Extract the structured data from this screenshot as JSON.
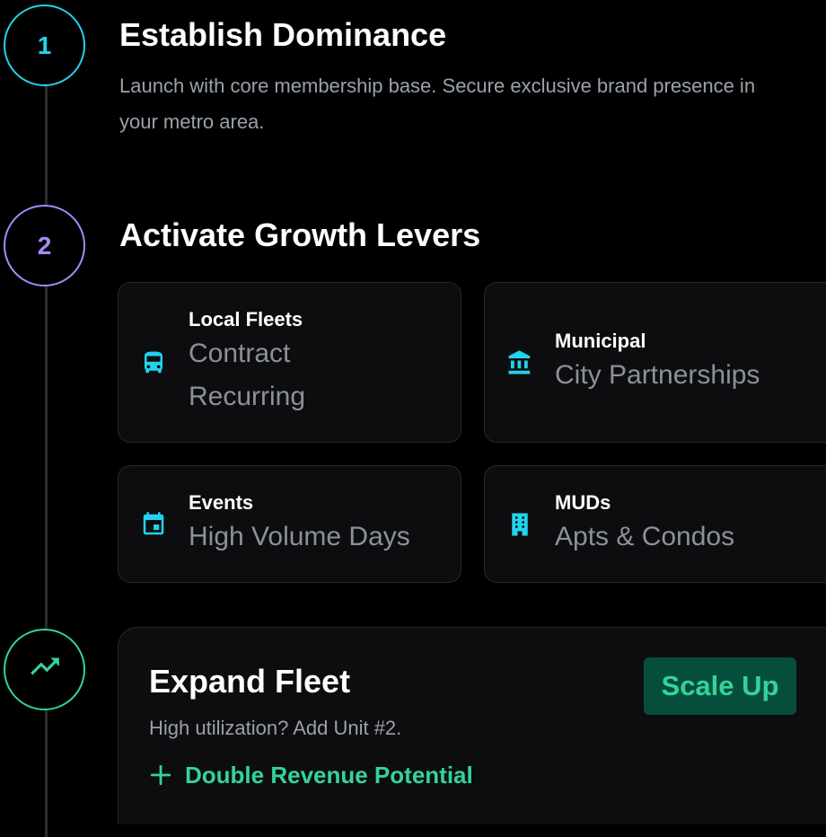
{
  "steps": [
    {
      "number": "1",
      "title": "Establish Dominance",
      "description": "Launch with core membership base. Secure exclusive brand presence in your metro area.",
      "color": "#22d3ee"
    },
    {
      "number": "2",
      "title": "Activate Growth Levers",
      "color": "#a78bfa"
    },
    {
      "icon": "trending-up-icon",
      "color": "#34d399"
    }
  ],
  "levers": [
    {
      "title": "Local Fleets",
      "subtitle": "Contract Recurring",
      "icon": "bus-icon"
    },
    {
      "title": "Municipal",
      "subtitle": "City Partnerships",
      "icon": "bank-icon"
    },
    {
      "title": "Events",
      "subtitle": "High Volume Days",
      "icon": "calendar-icon"
    },
    {
      "title": "MUDs",
      "subtitle": "Apts & Condos",
      "icon": "apartment-building-icon"
    }
  ],
  "expand": {
    "title": "Expand Fleet",
    "description": "High utilization? Add Unit #2.",
    "badge": "Scale Up",
    "cta": "Double Revenue Potential",
    "cta_icon": "plus-icon"
  },
  "colors": {
    "accent_cyan": "#22d3ee",
    "accent_purple": "#a78bfa",
    "accent_green": "#34d399",
    "badge_bg": "#064e3b",
    "card_bg": "#0d0d0f",
    "muted_text": "#9aa1ab"
  }
}
